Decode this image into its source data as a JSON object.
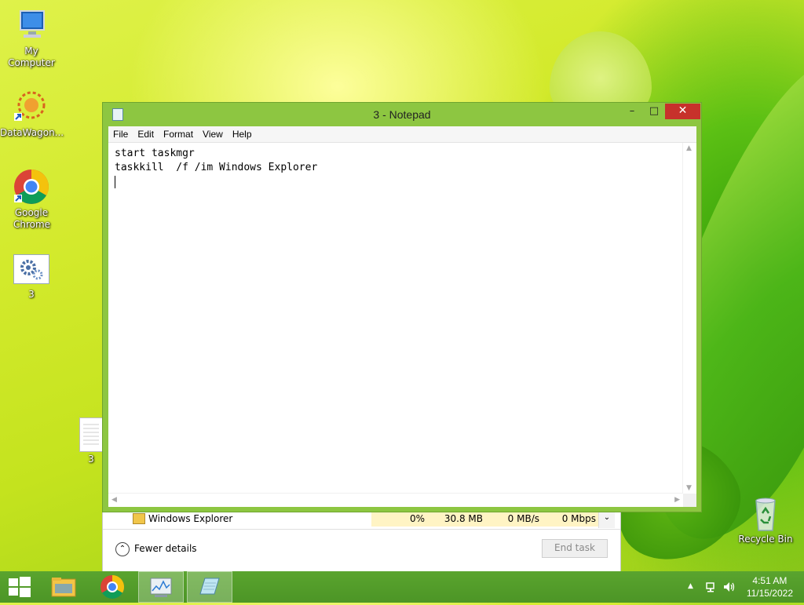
{
  "desktop": {
    "icons": [
      {
        "label": "My Computer"
      },
      {
        "label": "DataWagon..."
      },
      {
        "label": "Google Chrome"
      },
      {
        "label": "3"
      },
      {
        "label": "3"
      },
      {
        "label": "Recycle Bin"
      }
    ]
  },
  "taskmanager": {
    "process_name": "Windows Explorer",
    "cpu": "0%",
    "memory": "30.8 MB",
    "disk": "0 MB/s",
    "network": "0 Mbps",
    "fewer_details": "Fewer details",
    "end_task": "End task"
  },
  "notepad": {
    "title": "3 - Notepad",
    "menu": [
      "File",
      "Edit",
      "Format",
      "View",
      "Help"
    ],
    "lines": [
      "start taskmgr",
      "taskkill  /f /im Windows Explorer"
    ]
  },
  "taskbar": {
    "time": "4:51 AM",
    "date": "11/15/2022"
  },
  "colors": {
    "window_frame": "#8dc641",
    "close_button": "#c7312b",
    "taskbar": "#4f9a28"
  }
}
